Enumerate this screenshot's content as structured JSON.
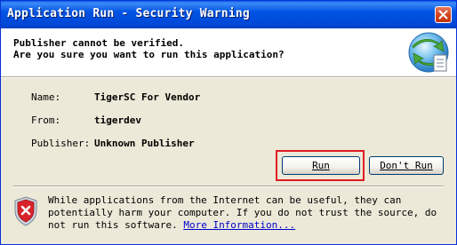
{
  "window": {
    "title": "Application Run - Security Warning",
    "close_symbol": "close-icon"
  },
  "header": {
    "line1": "Publisher cannot be verified.",
    "line2": "Are you sure you want to run this application?",
    "logo_icon": "application-security-globe-icon"
  },
  "details": {
    "name_label": "Name:",
    "name_value": "TigerSC For Vendor",
    "from_label": "From:",
    "from_value": "tigerdev",
    "publisher_label": "Publisher:",
    "publisher_value": "Unknown Publisher"
  },
  "buttons": {
    "run_label": "Run",
    "dont_run_label": "Don't Run"
  },
  "warning": {
    "icon": "shield-warning-icon",
    "text": "While applications from the Internet can be useful, they can potentially harm your computer. If you do not trust the source, do not run this software.",
    "link": "More Information..."
  },
  "colors": {
    "titlebar": "#0054e3",
    "dialog_bg": "#ece9d8",
    "highlight": "#e11d23",
    "link": "#0000cc"
  }
}
